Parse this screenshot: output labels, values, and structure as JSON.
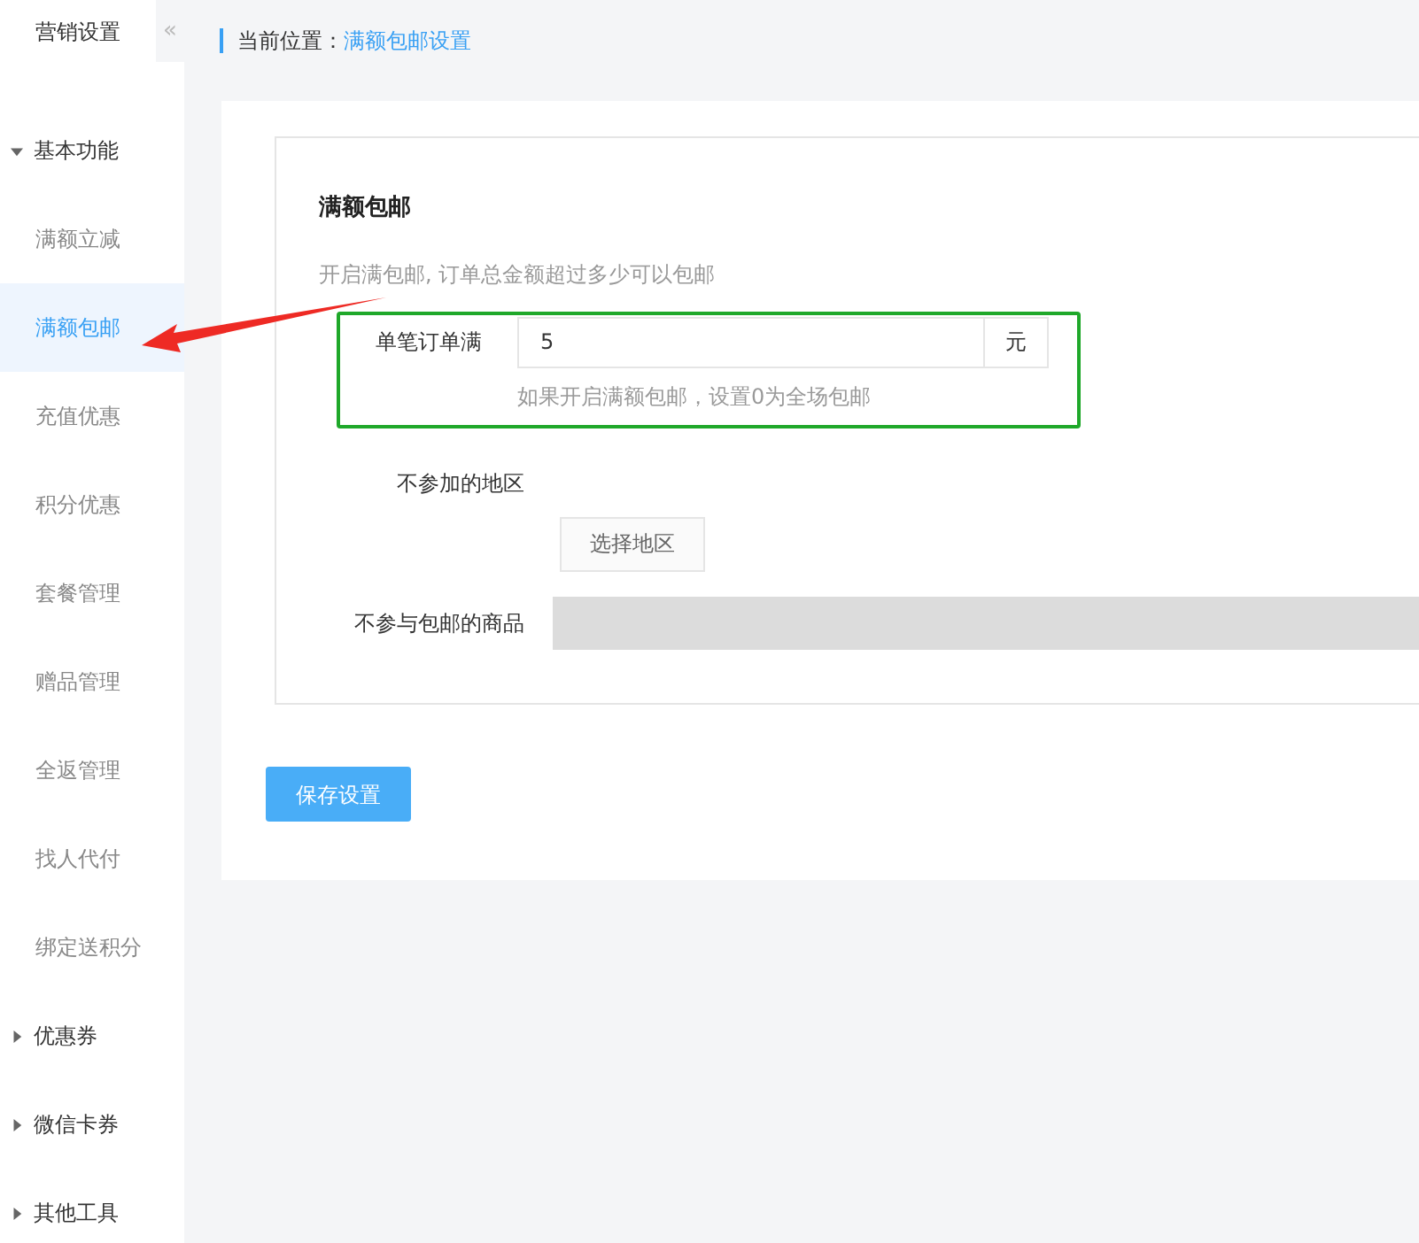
{
  "sidebar": {
    "title": "营销设置",
    "collapse_toggle": "«",
    "groups": [
      {
        "label": "基本功能",
        "expanded": true,
        "children": [
          {
            "label": "满额立减",
            "selected": false
          },
          {
            "label": "满额包邮",
            "selected": true
          },
          {
            "label": "充值优惠",
            "selected": false
          },
          {
            "label": "积分优惠",
            "selected": false
          },
          {
            "label": "套餐管理",
            "selected": false
          },
          {
            "label": "赠品管理",
            "selected": false
          },
          {
            "label": "全返管理",
            "selected": false
          },
          {
            "label": "找人代付",
            "selected": false
          },
          {
            "label": "绑定送积分",
            "selected": false
          }
        ]
      },
      {
        "label": "优惠券",
        "expanded": false
      },
      {
        "label": "微信卡券",
        "expanded": false
      },
      {
        "label": "其他工具",
        "expanded": false
      }
    ]
  },
  "breadcrumb": {
    "prefix": "当前位置：",
    "current": "满额包邮设置"
  },
  "form": {
    "title": "满额包邮",
    "description": "开启满包邮, 订单总金额超过多少可以包邮",
    "threshold": {
      "label": "单笔订单满",
      "value": "5",
      "unit": "元",
      "help": "如果开启满额包邮，设置0为全场包邮"
    },
    "region": {
      "label": "不参加的地区",
      "button": "选择地区"
    },
    "products": {
      "label": "不参与包邮的商品"
    },
    "save_button": "保存设置"
  }
}
